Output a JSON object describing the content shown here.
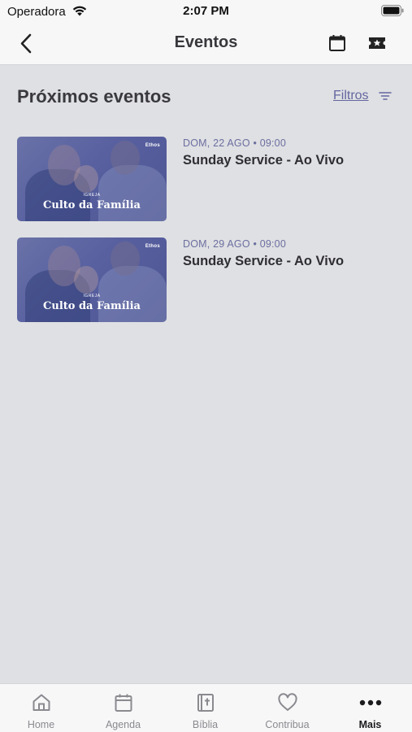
{
  "status_bar": {
    "carrier": "Operadora",
    "time": "2:07 PM"
  },
  "header": {
    "title": "Eventos"
  },
  "section": {
    "title": "Próximos eventos",
    "filters_label": "Filtros"
  },
  "events": [
    {
      "date": "DOM, 22 AGO • 09:00",
      "title": "Sunday Service - Ao Vivo",
      "thumbnail_title": "Culto da Família",
      "thumbnail_caption": "IGREJA",
      "thumbnail_logo": "Ethos"
    },
    {
      "date": "DOM, 29 AGO • 09:00",
      "title": "Sunday Service - Ao Vivo",
      "thumbnail_title": "Culto da Família",
      "thumbnail_caption": "IGREJA",
      "thumbnail_logo": "Ethos"
    }
  ],
  "tab_bar": {
    "tabs": [
      {
        "label": "Home",
        "icon": "home-icon"
      },
      {
        "label": "Agenda",
        "icon": "calendar-icon"
      },
      {
        "label": "Bíblia",
        "icon": "bible-icon"
      },
      {
        "label": "Contribua",
        "icon": "heart-icon"
      },
      {
        "label": "Mais",
        "icon": "more-icon"
      }
    ],
    "active": "Mais"
  },
  "colors": {
    "accent": "#6466a0",
    "background": "#dfe0e3",
    "bar": "#f7f7f8"
  }
}
